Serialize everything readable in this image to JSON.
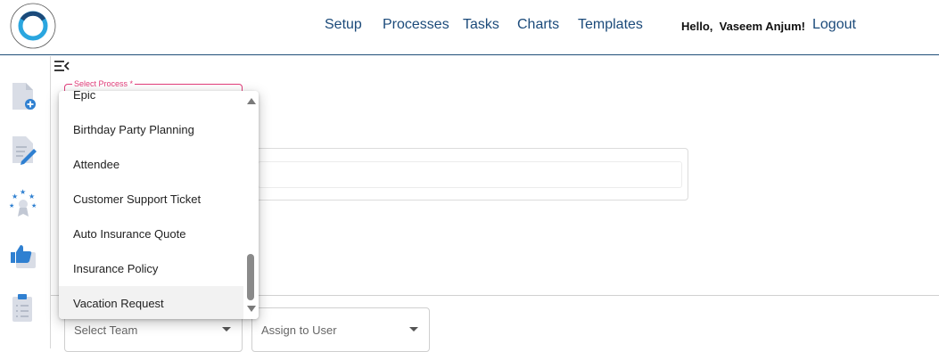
{
  "header": {
    "logo_alt": "MY BIZ WORKFLOW",
    "nav": [
      "Setup",
      "Processes",
      "Tasks",
      "Charts",
      "Templates"
    ],
    "greeting_prefix": "Hello,",
    "user_name": "Vaseem Anjum!",
    "logout_label": "Logout"
  },
  "sidebar": {
    "icons": [
      "new-document-icon",
      "edit-document-icon",
      "award-icon",
      "thumbs-up-icon",
      "checklist-icon"
    ]
  },
  "form": {
    "select_process_label": "Select Process *",
    "team_placeholder": "Select Team",
    "user_placeholder": "Assign to User"
  },
  "dropdown": {
    "items": [
      "Epic",
      "Birthday Party Planning",
      "Attendee",
      "Customer Support Ticket",
      "Auto Insurance Quote",
      "Insurance Policy",
      "Vacation Request"
    ],
    "highlighted": "Vacation Request"
  },
  "colors": {
    "nav_text": "#1b4a7a",
    "accent_pink": "#e23d7a",
    "icon_blue": "#2f80d1"
  }
}
